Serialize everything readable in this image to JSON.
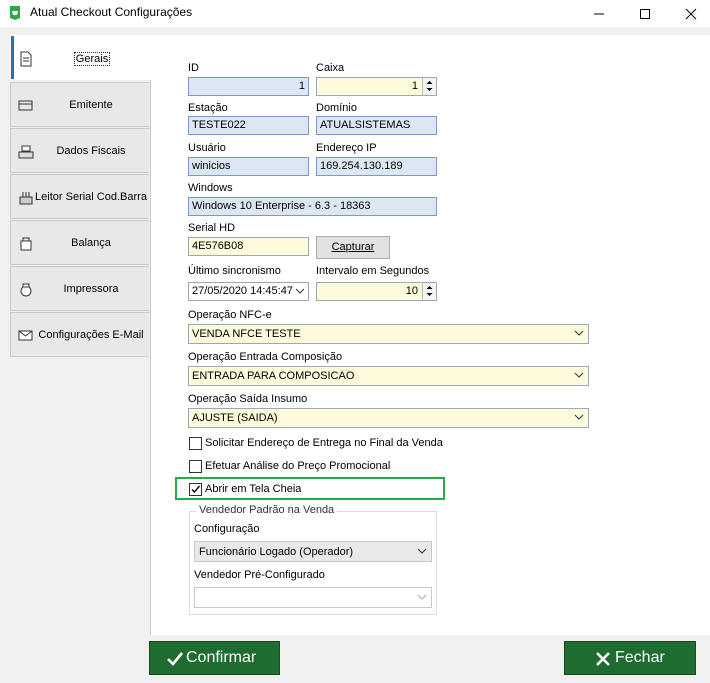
{
  "window": {
    "title": "Atual Checkout Configurações",
    "accent_color": "#1e6c2f",
    "highlight_color": "#2aa84a"
  },
  "tabs": [
    {
      "label": "Gerais",
      "icon": "document-icon",
      "active": true
    },
    {
      "label": "Emitente",
      "icon": "card-icon"
    },
    {
      "label": "Dados Fiscais",
      "icon": "cash-register-icon"
    },
    {
      "label": "Leitor Serial Cod.Barra",
      "icon": "barcode-scanner-icon"
    },
    {
      "label": "Balança",
      "icon": "scale-icon"
    },
    {
      "label": "Impressora",
      "icon": "printer-icon"
    },
    {
      "label": "Configurações E-Mail",
      "icon": "email-icon"
    }
  ],
  "form": {
    "id_label": "ID",
    "id_value": "1",
    "caixa_label": "Caixa",
    "caixa_value": "1",
    "estacao_label": "Estação",
    "estacao_value": "TESTE022",
    "dominio_label": "Domínio",
    "dominio_value": "ATUALSISTEMAS",
    "usuario_label": "Usuário",
    "usuario_value": "winicios",
    "ip_label": "Endereço IP",
    "ip_value": "169.254.130.189",
    "windows_label": "Windows",
    "windows_value": "Windows 10 Enterprise - 6.3 - 18363",
    "serial_label": "Serial HD",
    "serial_value": "4E576B08",
    "capturar_label": "Capturar",
    "sync_label": "Último sincronismo",
    "sync_value": "27/05/2020 14:45:47",
    "intervalo_label": "Intervalo em Segundos",
    "intervalo_value": "10",
    "op_nfce_label": "Operação NFC-e",
    "op_nfce_value": "VENDA NFCE TESTE",
    "op_entrada_label": "Operação Entrada Composição",
    "op_entrada_value": "ENTRADA PARA COMPOSICAO",
    "op_saida_label": "Operação Saída Insumo",
    "op_saida_value": "AJUSTE (SAIDA)"
  },
  "checkboxes": [
    {
      "label": "Solicitar Endereço de Entrega no Final da Venda",
      "checked": false
    },
    {
      "label": "Efetuar Análise do Preço Promocional",
      "checked": false
    },
    {
      "label": "Abrir em Tela Cheia",
      "checked": true
    }
  ],
  "vendedor": {
    "group_title": "Vendedor Padrão na Venda",
    "config_label": "Configuração",
    "config_value": "Funcionário Logado (Operador)",
    "preconf_label": "Vendedor Pré-Configurado",
    "preconf_value": ""
  },
  "footer": {
    "confirm_label": "Confirmar",
    "close_label": "Fechar"
  }
}
